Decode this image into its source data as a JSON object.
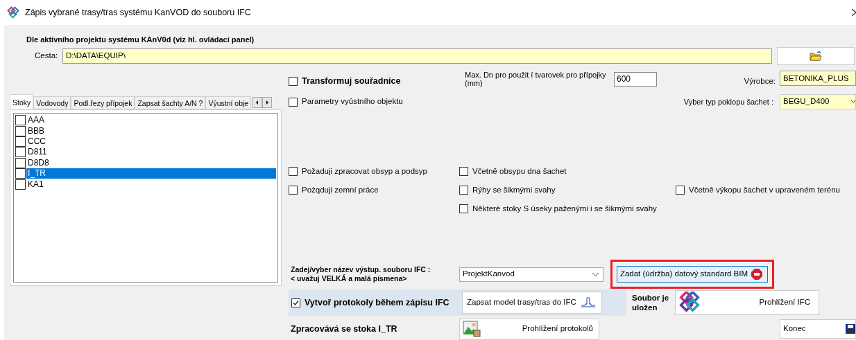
{
  "window": {
    "title": "Zápis vybrané trasy/tras systému KanVOD do souboru IFC"
  },
  "heading": "Dle aktivního projektu systému KAnV0d (viz hl. ovládací panel)",
  "path": {
    "label": "Cesta:",
    "value": "D:\\DATA\\EQUIP\\"
  },
  "tabs": [
    {
      "label": "Stoky",
      "selected": true
    },
    {
      "label": "Vodovody",
      "selected": false
    },
    {
      "label": "Podl.řezy přípojek",
      "selected": false
    },
    {
      "label": "Zapsat šachty A/N ?",
      "selected": false
    },
    {
      "label": "Výustní obje",
      "selected": false
    }
  ],
  "sewers": [
    {
      "name": "AAA",
      "checked": false,
      "selected": false
    },
    {
      "name": "BBB",
      "checked": false,
      "selected": false
    },
    {
      "name": "CCC",
      "checked": false,
      "selected": false
    },
    {
      "name": "D811",
      "checked": false,
      "selected": false
    },
    {
      "name": "D8D8",
      "checked": false,
      "selected": false
    },
    {
      "name": "I_TR",
      "checked": false,
      "selected": true
    },
    {
      "name": "KA1",
      "checked": false,
      "selected": false
    }
  ],
  "transform": {
    "label": "Transformuj  souřadnice",
    "checked": false
  },
  "outlet_params": {
    "label": "Parametry vyústního objektu",
    "checked": false
  },
  "max_dn": {
    "label": "Max. Dn pro použit í tvarovek pro přípojky (mm)",
    "value": "600"
  },
  "manufacturer": {
    "label": "Výrobce:",
    "value": "BETONIKA_PLUS"
  },
  "cover_type": {
    "label": "Vyber typ poklopu šachet :",
    "value": "BEGU_D400"
  },
  "option_columns": [
    [
      {
        "label": "Požaduji zpracovat obsyp a podsyp",
        "checked": false
      },
      {
        "label": "Pożqduji zemní práce",
        "checked": false
      }
    ],
    [
      {
        "label": "Včetně obsypu dna šachet",
        "checked": false
      },
      {
        "label": "Rýhy se šikmými svahy",
        "checked": false
      },
      {
        "label": "Některé stoky S úseky paženými i se šikmými svahy",
        "checked": false
      }
    ],
    [
      {
        "label": "Včetně výkopu šachet v upraveném terénu",
        "checked": false
      }
    ]
  ],
  "output_file": {
    "label_line_1": "Zadej/vyber název výstup. souboru IFC :",
    "label_line_2": "< uvažuj VELKÁ a malá písmena>",
    "value": "ProjektKanvod"
  },
  "bim_button": {
    "label": "Zadat (údržba) datový standard BIM",
    "highlighted": true
  },
  "protocols": {
    "label": "Vytvoř protokoly během zápisu IFC",
    "checked": true
  },
  "write_button": {
    "label": "Zapsat model trasy/tras do IFC"
  },
  "saved_status": "Soubor je uložen",
  "ifc_button": {
    "label": "Prohlížení IFC"
  },
  "processing": "Zpracovává se stoka I_TR",
  "protocols_button": {
    "label": "Prohlížení protokolů"
  },
  "close_button": {
    "label": "Konec"
  }
}
